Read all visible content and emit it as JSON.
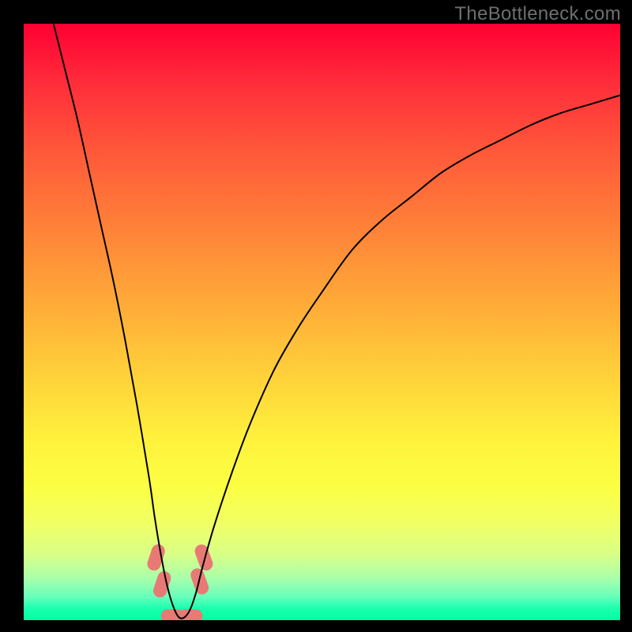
{
  "watermark": "TheBottleneck.com",
  "colors": {
    "frame": "#000000",
    "curve": "#000000",
    "blob": "#e77a75"
  },
  "chart_data": {
    "type": "line",
    "title": "",
    "xlabel": "",
    "ylabel": "",
    "xlim": [
      0,
      100
    ],
    "ylim": [
      0,
      100
    ],
    "note": "Values estimated from pixel positions; chart has no axes or tick labels. y represents bottleneck percentage (0 near bottom, 100 at top). Curve minimum ≈ x 24–28.",
    "series": [
      {
        "name": "bottleneck-curve",
        "x": [
          5,
          7,
          9,
          11,
          13,
          15,
          17,
          19,
          21,
          22,
          23,
          24,
          25,
          26,
          27,
          28,
          29,
          30,
          32,
          35,
          38,
          42,
          46,
          50,
          55,
          60,
          65,
          70,
          75,
          80,
          85,
          90,
          95,
          100
        ],
        "y": [
          100,
          92,
          84,
          75,
          66,
          57,
          47,
          36,
          24,
          17,
          11,
          6,
          2.5,
          0.5,
          0.5,
          2,
          5,
          9,
          16,
          25,
          33,
          42,
          49,
          55,
          62,
          67,
          71,
          75,
          78,
          80.5,
          83,
          85,
          86.5,
          88
        ]
      }
    ],
    "markers": [
      {
        "name": "marker-a",
        "x": 22.2,
        "y": 10.5
      },
      {
        "name": "marker-b",
        "x": 23.2,
        "y": 6.0
      },
      {
        "name": "marker-c",
        "x": 25.0,
        "y": 0.7
      },
      {
        "name": "marker-d",
        "x": 28.0,
        "y": 0.7
      },
      {
        "name": "marker-e",
        "x": 29.5,
        "y": 6.5
      },
      {
        "name": "marker-f",
        "x": 30.2,
        "y": 10.5
      }
    ]
  }
}
